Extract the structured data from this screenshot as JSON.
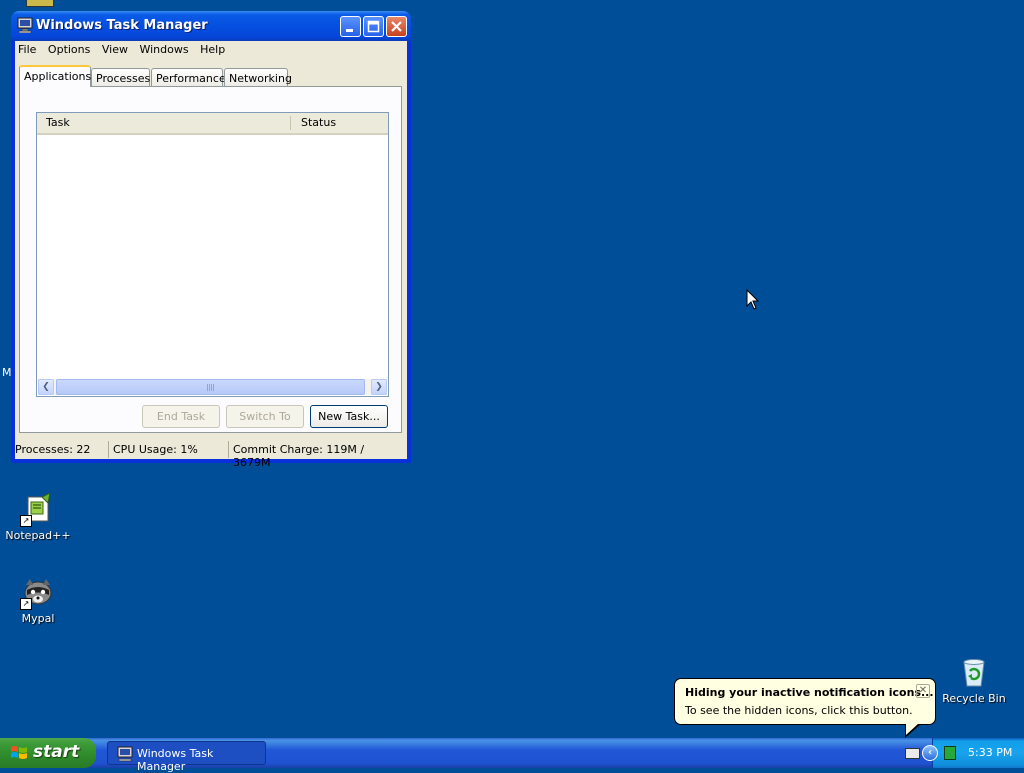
{
  "window": {
    "title": "Windows Task Manager",
    "menu": [
      "File",
      "Options",
      "View",
      "Windows",
      "Help"
    ],
    "tabs": [
      {
        "label": "Applications",
        "active": true
      },
      {
        "label": "Processes",
        "active": false
      },
      {
        "label": "Performance",
        "active": false
      },
      {
        "label": "Networking",
        "active": false
      }
    ],
    "list": {
      "columns": [
        "Task",
        "Status"
      ],
      "rows": []
    },
    "buttons": {
      "end_task": "End Task",
      "switch_to": "Switch To",
      "new_task": "New Task..."
    },
    "status": {
      "processes": "Processes: 22",
      "cpu": "CPU Usage: 1%",
      "commit": "Commit Charge: 119M / 3679M"
    }
  },
  "desktop": {
    "icons": [
      {
        "label": "Notepad++",
        "icon": "notepadpp-icon"
      },
      {
        "label": "Mypal",
        "icon": "mypal-raccoon-icon"
      },
      {
        "label": "Recycle Bin",
        "icon": "recycle-bin-icon"
      }
    ],
    "edge_text": "M"
  },
  "taskbar": {
    "start_label": "start",
    "task_button": "Windows Task Manager",
    "clock": "5:33 PM"
  },
  "balloon": {
    "title": "Hiding your inactive notification icons...",
    "text": "To see the hidden icons, click this button."
  },
  "colors": {
    "desktop": "#004E98",
    "titlebar": "#0550E0",
    "start_button": "#3C9A37",
    "taskbar": "#2157D7",
    "active_tab_highlight": "#FFC83C",
    "balloon_bg": "#FFFFE1"
  }
}
